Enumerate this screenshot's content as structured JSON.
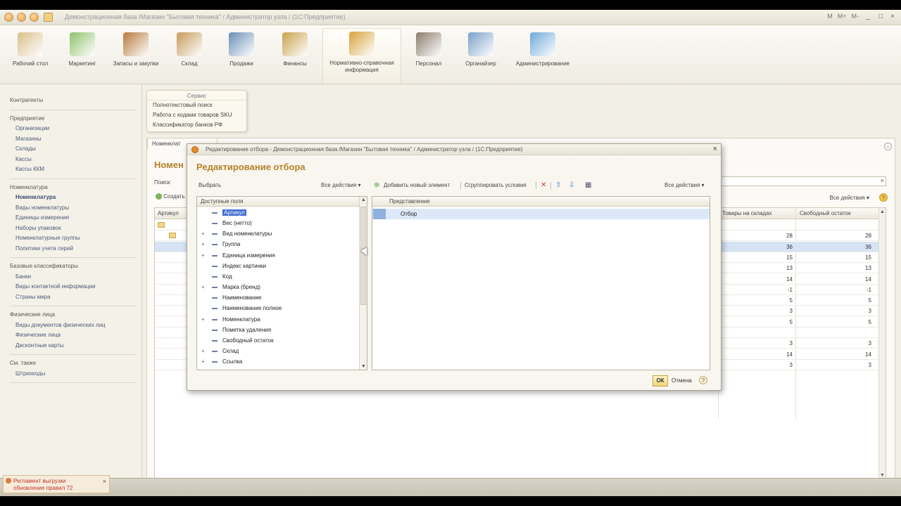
{
  "window": {
    "title": "Демонстрационная база /Магазин \"Бытовая техника\" / Администратор узла / (1С:Предприятие)",
    "tools": [
      "M",
      "M+",
      "M-"
    ]
  },
  "sections": [
    {
      "label": "Рабочий стол",
      "color": "#d9c08a"
    },
    {
      "label": "Маркетинг",
      "color": "#8fc26a"
    },
    {
      "label": "Запасы и закупки",
      "color": "#b57a3c"
    },
    {
      "label": "Склад",
      "color": "#c89a5a"
    },
    {
      "label": "Продажи",
      "color": "#6a8fb5"
    },
    {
      "label": "Финансы",
      "color": "#c9a24c"
    },
    {
      "label": "Нормативно-справочная информация",
      "color": "#d6a33a"
    },
    {
      "label": "Персонал",
      "color": "#8a7a6a"
    },
    {
      "label": "Органайзер",
      "color": "#7aa0c8"
    },
    {
      "label": "Администрирование",
      "color": "#6fa8d6"
    }
  ],
  "leftnav": {
    "groups": [
      {
        "items": [
          {
            "label": "Контрагенты",
            "kind": "group"
          }
        ]
      },
      {
        "items": [
          {
            "label": "Предприятие",
            "kind": "group"
          },
          {
            "label": "Организации",
            "kind": "sub"
          },
          {
            "label": "Магазины",
            "kind": "sub"
          },
          {
            "label": "Склады",
            "kind": "sub"
          },
          {
            "label": "Кассы",
            "kind": "sub"
          },
          {
            "label": "Кассы ККМ",
            "kind": "sub"
          }
        ]
      },
      {
        "items": [
          {
            "label": "Номенклатура",
            "kind": "group"
          },
          {
            "label": "Номенклатура",
            "kind": "active"
          },
          {
            "label": "Виды номенклатуры",
            "kind": "sub"
          },
          {
            "label": "Единицы измерения",
            "kind": "sub"
          },
          {
            "label": "Наборы упаковок",
            "kind": "sub"
          },
          {
            "label": "Номенклатурные группы",
            "kind": "sub"
          },
          {
            "label": "Политики учета серий",
            "kind": "sub"
          }
        ]
      },
      {
        "items": [
          {
            "label": "Базовые классификаторы",
            "kind": "group"
          },
          {
            "label": "Банки",
            "kind": "sub"
          },
          {
            "label": "Виды контактной информации",
            "kind": "sub"
          },
          {
            "label": "Страны мира",
            "kind": "sub"
          }
        ]
      },
      {
        "items": [
          {
            "label": "Физические лица",
            "kind": "group"
          },
          {
            "label": "Виды документов физических лиц",
            "kind": "sub"
          },
          {
            "label": "Физические лица",
            "kind": "sub"
          },
          {
            "label": "Дисконтные карты",
            "kind": "sub"
          }
        ]
      },
      {
        "items": [
          {
            "label": "См. также",
            "kind": "group"
          },
          {
            "label": "Штрихкоды",
            "kind": "sub"
          }
        ]
      }
    ]
  },
  "service": {
    "title": "Сервис",
    "items": [
      "Полнотекстовый поиск",
      "Работа с кодами товаров SKU",
      "Классификатор банков РФ"
    ]
  },
  "main": {
    "tab": "Номенклат",
    "heading": "Номен",
    "search_label": "Поиск:",
    "create_label": "Создать",
    "all_actions": "Все действия ▾",
    "columns": [
      "Артикул",
      "Товары на складах",
      "Свободный остаток"
    ],
    "rows": [
      {
        "a": "",
        "b": "",
        "sel": false
      },
      {
        "a": "28",
        "b": "28",
        "sel": false
      },
      {
        "a": "36",
        "b": "36",
        "sel": true
      },
      {
        "a": "15",
        "b": "15",
        "sel": false
      },
      {
        "a": "13",
        "b": "13",
        "sel": false
      },
      {
        "a": "14",
        "b": "14",
        "sel": false
      },
      {
        "a": "-1",
        "b": "-1",
        "sel": false
      },
      {
        "a": "5",
        "b": "5",
        "sel": false
      },
      {
        "a": "3",
        "b": "3",
        "sel": false
      },
      {
        "a": "5",
        "b": "5",
        "sel": false
      },
      {
        "a": "",
        "b": "",
        "sel": false
      },
      {
        "a": "3",
        "b": "3",
        "sel": false
      },
      {
        "a": "14",
        "b": "14",
        "sel": false
      },
      {
        "a": "3",
        "b": "3",
        "sel": false
      }
    ]
  },
  "modal": {
    "title": "Редактирование отбора - Демонстрационная база /Магазин \"Бытовая техника\" / Администратор узла / (1С:Предприятие)",
    "heading": "Редактирование отбора",
    "toolbar": {
      "select": "Выбрать",
      "all_actions_left": "Все действия ▾",
      "add_element": "Добавить новый элемент",
      "group_conditions": "Сгруппировать условия",
      "all_actions_right": "Все действия ▾"
    },
    "available_fields_header": "Доступные поля",
    "fields": [
      {
        "label": "Артикул",
        "expandable": false,
        "selected": true
      },
      {
        "label": "Вес (нетто)",
        "expandable": false,
        "selected": false
      },
      {
        "label": "Вид номенклатуры",
        "expandable": true,
        "selected": false
      },
      {
        "label": "Группа",
        "expandable": true,
        "selected": false
      },
      {
        "label": "Единица измерения",
        "expandable": true,
        "selected": false
      },
      {
        "label": "Индекс картинки",
        "expandable": false,
        "selected": false
      },
      {
        "label": "Код",
        "expandable": false,
        "selected": false
      },
      {
        "label": "Марка (бренд)",
        "expandable": true,
        "selected": false
      },
      {
        "label": "Наименование",
        "expandable": false,
        "selected": false
      },
      {
        "label": "Наименование полное",
        "expandable": false,
        "selected": false
      },
      {
        "label": "Номенклатура",
        "expandable": true,
        "selected": false
      },
      {
        "label": "Пометка удаления",
        "expandable": false,
        "selected": false
      },
      {
        "label": "Свободный остаток",
        "expandable": false,
        "selected": false
      },
      {
        "label": "Склад",
        "expandable": true,
        "selected": false
      },
      {
        "label": "Ссылка",
        "expandable": true,
        "selected": false
      }
    ],
    "representation_header": "Представление",
    "filter_row": "Отбор",
    "ok": "ОК",
    "cancel": "Отмена",
    "help": "?"
  },
  "notice": {
    "line1": "Регламент выгрузки",
    "line2": "обновление правил 72"
  }
}
